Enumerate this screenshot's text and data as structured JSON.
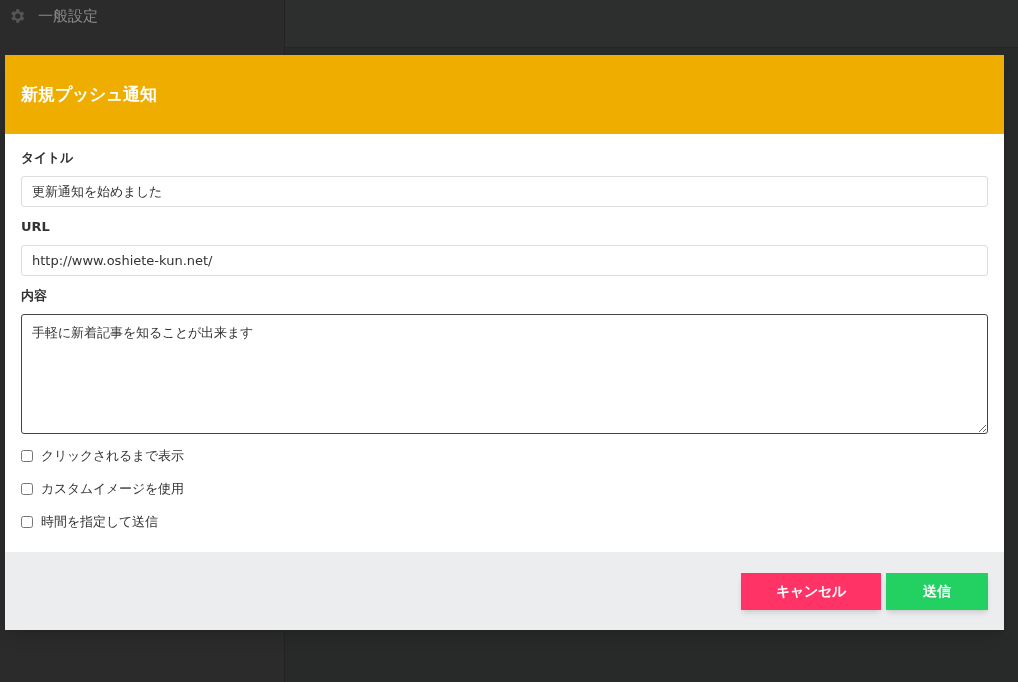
{
  "sidebar": {
    "items": [
      {
        "label": "一般設定"
      }
    ]
  },
  "dialog": {
    "title": "新規プッシュ通知",
    "fields": [
      {
        "kind": "input",
        "label": "タイトル",
        "value": "更新通知を始めました"
      },
      {
        "kind": "input",
        "label": "URL",
        "value": "http://www.oshiete-kun.net/"
      },
      {
        "kind": "textarea",
        "label": "内容",
        "value": "手軽に新着記事を知ることが出来ます"
      }
    ],
    "options": [
      {
        "label": "クリックされるまで表示",
        "checked": false
      },
      {
        "label": "カスタムイメージを使用",
        "checked": false
      },
      {
        "label": "時間を指定して送信",
        "checked": false
      }
    ],
    "buttons": [
      {
        "kind": "cancel",
        "label": "キャンセル"
      },
      {
        "kind": "submit",
        "label": "送信"
      }
    ]
  }
}
